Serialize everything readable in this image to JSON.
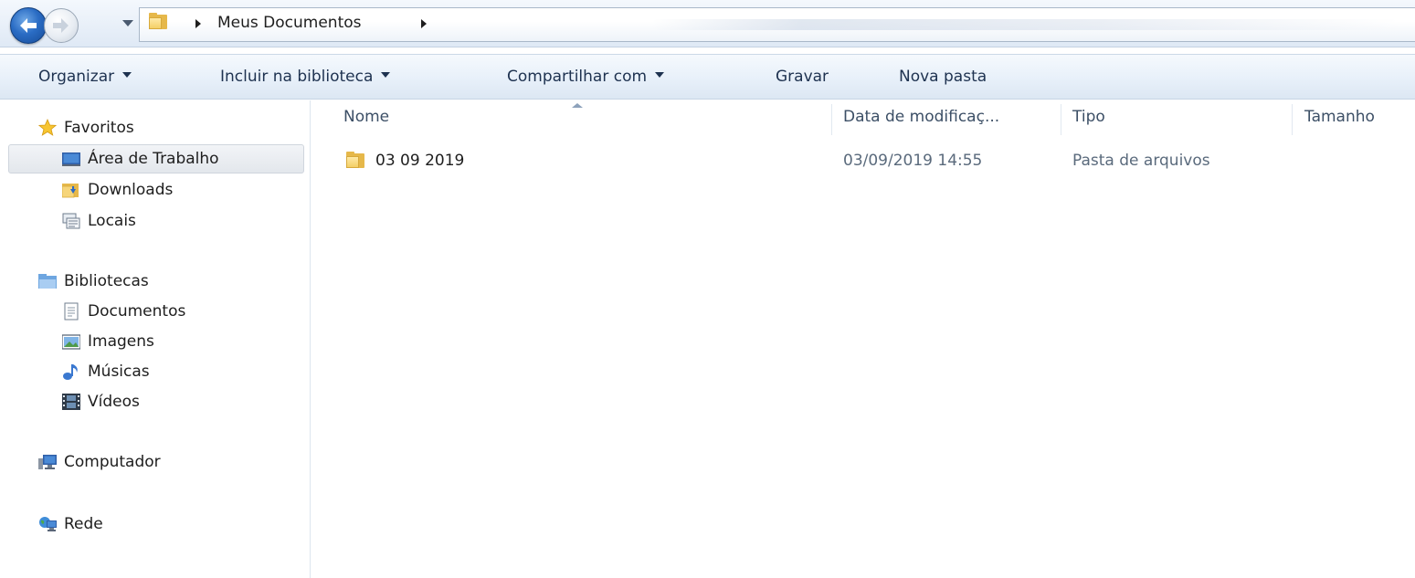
{
  "address_bar": {
    "path": [
      "Meus Documentos"
    ]
  },
  "toolbar": {
    "organize": "Organizar",
    "include_library": "Incluir na biblioteca",
    "share_with": "Compartilhar com",
    "burn": "Gravar",
    "new_folder": "Nova pasta"
  },
  "nav_pane": {
    "favorites": {
      "label": "Favoritos",
      "items": [
        "Área de Trabalho",
        "Downloads",
        "Locais"
      ]
    },
    "libraries": {
      "label": "Bibliotecas",
      "items": [
        "Documentos",
        "Imagens",
        "Músicas",
        "Vídeos"
      ]
    },
    "computer": "Computador",
    "network": "Rede",
    "selected": "Área de Trabalho"
  },
  "file_list": {
    "columns": [
      "Nome",
      "Data de modificaç...",
      "Tipo",
      "Tamanho"
    ],
    "rows": [
      {
        "name": "03 09 2019",
        "date": "03/09/2019 14:55",
        "type": "Pasta de arquivos",
        "size": "",
        "icon": "folder-icon"
      }
    ]
  },
  "colors": {
    "toolbar_text": "#1e3250",
    "header_text": "#3c4f66",
    "folder": "#e6b84a",
    "accent_blue": "#2a6cc4"
  }
}
